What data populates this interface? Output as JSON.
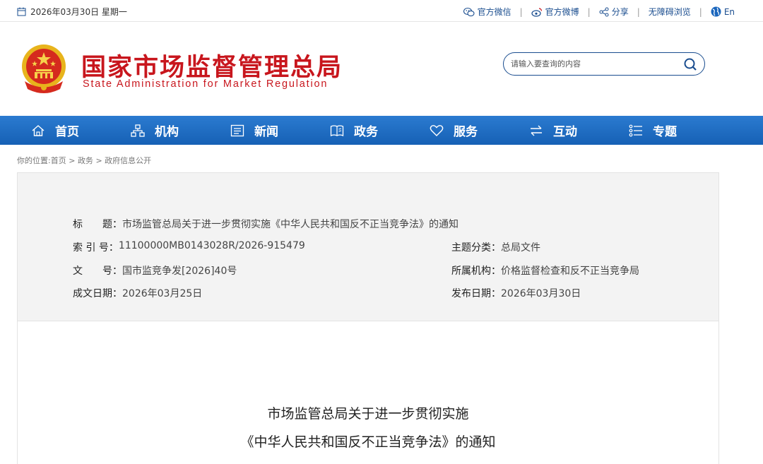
{
  "topbar": {
    "date": "2026年03月30日 星期一",
    "links": [
      "官方微信",
      "官方微博",
      "分享",
      "无障碍浏览",
      "En"
    ]
  },
  "header": {
    "title_cn": "国家市场监督管理总局",
    "title_en": "State Administration for Market Regulation",
    "search_placeholder": "请输入要查询的内容"
  },
  "nav": {
    "items": [
      "首页",
      "机构",
      "新闻",
      "政务",
      "服务",
      "互动",
      "专题"
    ]
  },
  "breadcrumb": {
    "prefix": "你的位置:",
    "items": [
      "首页",
      "政务",
      "政府信息公开"
    ],
    "sep": ">"
  },
  "meta": {
    "title_label": "标　　题：",
    "title_value": "市场监管总局关于进一步贯彻实施《中华人民共和国反不正当竞争法》的通知",
    "index_label": "索 引 号：",
    "index_value": "11100000MB0143028R/2026-915479",
    "topic_label": "主题分类：",
    "topic_value": "总局文件",
    "docno_label": "文　　号：",
    "docno_value": "国市监竞争发[2026]40号",
    "org_label": "所属机构：",
    "org_value": "价格监督检查和反不正当竞争局",
    "date_label": "成文日期：",
    "date_value": "2026年03月25日",
    "pub_label": "发布日期：",
    "pub_value": "2026年03月30日"
  },
  "document": {
    "title_line1": "市场监管总局关于进一步贯彻实施",
    "title_line2": "《中华人民共和国反不正当竞争法》的通知"
  },
  "colors": {
    "brand_red": "#c8161d",
    "nav_blue": "#1a66bd",
    "link_blue": "#1a4d8f"
  }
}
